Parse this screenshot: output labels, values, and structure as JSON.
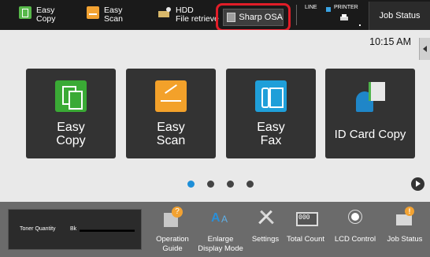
{
  "topbar": {
    "quick_items": [
      {
        "label_line1": "Easy",
        "label_line2": "Copy",
        "icon": "copy-icon"
      },
      {
        "label_line1": "Easy",
        "label_line2": "Scan",
        "icon": "scan-icon"
      },
      {
        "label_line1": "HDD",
        "label_line2": "File retrieve",
        "icon": "folder-icon"
      }
    ],
    "osa_label": "Sharp OSA",
    "line_label": "LINE",
    "printer_label": "PRINTER",
    "job_status_label": "Job Status"
  },
  "clock": "10:15 AM",
  "tiles": [
    {
      "line1": "Easy",
      "line2": "Copy",
      "icon": "copy-icon"
    },
    {
      "line1": "Easy",
      "line2": "Scan",
      "icon": "scan-icon"
    },
    {
      "line1": "Easy",
      "line2": "Fax",
      "icon": "fax-icon"
    },
    {
      "label": "ID Card Copy",
      "icon": "id-card-icon"
    }
  ],
  "pager": {
    "pages": 4,
    "current": 1
  },
  "bottom": {
    "toner_label": "Toner Quantity",
    "toner_color": "Bk",
    "items": [
      {
        "line1": "Operation",
        "line2": "Guide",
        "icon": "guide-icon"
      },
      {
        "line1": "Enlarge",
        "line2": "Display Mode",
        "icon": "enlarge-icon"
      },
      {
        "line1": "Settings",
        "line2": "",
        "icon": "settings-icon"
      },
      {
        "line1": "Total Count",
        "line2": "",
        "icon": "counter-icon"
      },
      {
        "line1": "LCD Control",
        "line2": "",
        "icon": "brightness-icon"
      },
      {
        "line1": "Job Status",
        "line2": "",
        "icon": "job-status-icon"
      }
    ]
  },
  "colors": {
    "highlight": "#e11d28",
    "accent_blue": "#1e8fd8",
    "copy_green": "#3aaa35",
    "scan_orange": "#f3a12a",
    "fax_blue": "#1f9fd9"
  }
}
